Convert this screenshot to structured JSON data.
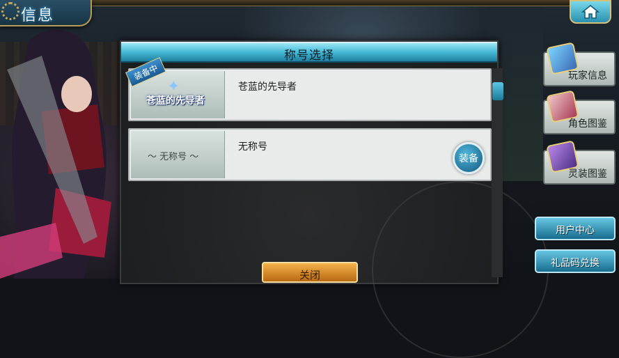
{
  "header": {
    "title": "信息"
  },
  "dialog": {
    "title": "称号选择",
    "rows": [
      {
        "badge": "装备中",
        "emblem_text": "苍蓝的先导者",
        "name": "苍蓝的先导者"
      },
      {
        "emblem_text": "～ 无称号 ～",
        "name": "无称号",
        "equip_label": "装备"
      }
    ],
    "close_label": "关闭"
  },
  "side_menu": [
    {
      "label": "玩家信息",
      "icon": "player-info-icon"
    },
    {
      "label": "角色图鉴",
      "icon": "character-gallery-icon"
    },
    {
      "label": "灵装图鉴",
      "icon": "equipment-gallery-icon"
    }
  ],
  "links": {
    "user_center": "用户中心",
    "gift_code": "礼品码兑换"
  },
  "colors": {
    "accent": "#45b9d6",
    "close_button": "#e8952c"
  }
}
